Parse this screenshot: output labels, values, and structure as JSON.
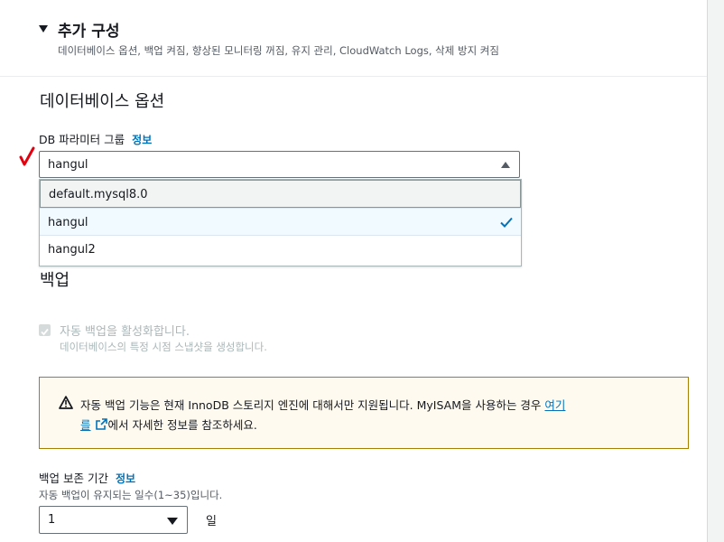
{
  "header": {
    "title": "추가 구성",
    "description": "데이터베이스 옵션, 백업 켜짐, 향상된 모니터링 꺼짐, 유지 관리, CloudWatch Logs, 삭제 방지 켜짐"
  },
  "db_options": {
    "section_title": "데이터베이스 옵션",
    "param_group_label": "DB 파라미터 그룹",
    "info_link": "정보",
    "selected_value": "hangul",
    "options": [
      "default.mysql8.0",
      "hangul",
      "hangul2"
    ]
  },
  "backup": {
    "section_title": "백업",
    "auto_backup_label": "자동 백업을 활성화합니다.",
    "auto_backup_desc": "데이터베이스의 특정 시점 스냅샷을 생성합니다.",
    "warning_line1": "자동 백업 기능은 현재 InnoDB 스토리지 엔진에 대해서만 지원됩니다. MyISAM을 사용하는 경우 ",
    "warning_link_part1": "여기",
    "warning_link_part2": "를",
    "warning_line2_rest": "에서 자세한 정보를 참조하세요.",
    "retention_label": "백업 보존 기간",
    "retention_info": "정보",
    "retention_desc": "자동 백업이 유지되는 일수(1~35)입니다.",
    "retention_value": "1",
    "retention_unit": "일"
  },
  "colors": {
    "link": "#0073bb",
    "warning_border": "#a57f00",
    "warning_bg": "#fffaef",
    "annotation_red": "#e3000f"
  }
}
